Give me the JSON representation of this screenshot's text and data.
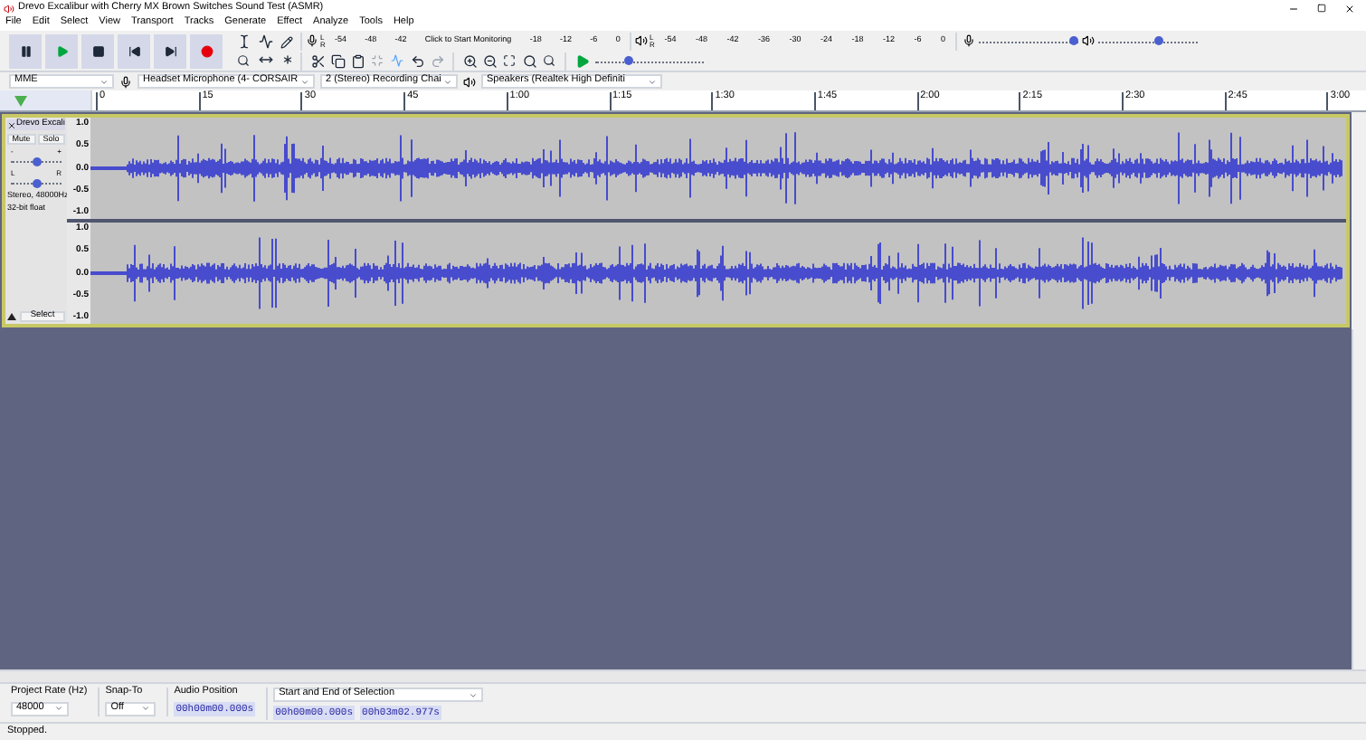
{
  "window": {
    "title": "Drevo Excalibur with Cherry MX Brown Switches Sound Test (ASMR)"
  },
  "menu": [
    "File",
    "Edit",
    "Select",
    "View",
    "Transport",
    "Tracks",
    "Generate",
    "Effect",
    "Analyze",
    "Tools",
    "Help"
  ],
  "recording_meter": {
    "labels": [
      "L",
      "R"
    ],
    "ticks_before": [
      "-54",
      "-48",
      "-42"
    ],
    "prompt": "Click to Start Monitoring",
    "ticks_after": [
      "-18",
      "-12",
      "-6",
      "0"
    ]
  },
  "playback_meter": {
    "labels": [
      "L",
      "R"
    ],
    "ticks": [
      "-54",
      "-48",
      "-42",
      "-36",
      "-30",
      "-24",
      "-18",
      "-12",
      "-6",
      "0"
    ]
  },
  "mixer": {
    "recording_volume": {
      "level": 0.95
    },
    "playback_volume": {
      "level": 0.6
    }
  },
  "play_at_speed": {
    "level": 0.3
  },
  "devices": {
    "host": "MME",
    "recording_device": "Headset Microphone (4- CORSAIR",
    "channels": "2 (Stereo) Recording Chai",
    "playback_device": "Speakers (Realtek High Definiti"
  },
  "timeline": {
    "ticks": [
      "0",
      "15",
      "30",
      "45",
      "1:00",
      "1:15",
      "1:30",
      "1:45",
      "2:00",
      "2:15",
      "2:30",
      "2:45",
      "3:00"
    ]
  },
  "track": {
    "name": "Drevo Excali",
    "mute": "Mute",
    "solo": "Solo",
    "gain": {
      "labels": [
        "-",
        "+"
      ],
      "level": 0.5
    },
    "pan": {
      "labels": [
        "L",
        "R"
      ],
      "level": 0.5
    },
    "info": [
      "Stereo, 48000Hz",
      "32-bit float"
    ],
    "select": "Select",
    "channels": [
      {
        "scale": [
          "1.0",
          "0.5",
          "0.0",
          "-0.5",
          "-1.0"
        ]
      },
      {
        "scale": [
          "1.0",
          "0.5",
          "0.0",
          "-0.5",
          "-1.0"
        ]
      }
    ]
  },
  "selection_toolbar": {
    "project_rate": {
      "label": "Project Rate (Hz)",
      "value": "48000"
    },
    "snap_to": {
      "label": "Snap-To",
      "value": "Off"
    },
    "audio_position": {
      "label": "Audio Position",
      "value": "00h00m00.000s"
    },
    "selection": {
      "label": "Start and End of Selection",
      "start": "00h00m00.000s",
      "end": "00h03m02.977s"
    }
  },
  "status_bar": "Stopped."
}
